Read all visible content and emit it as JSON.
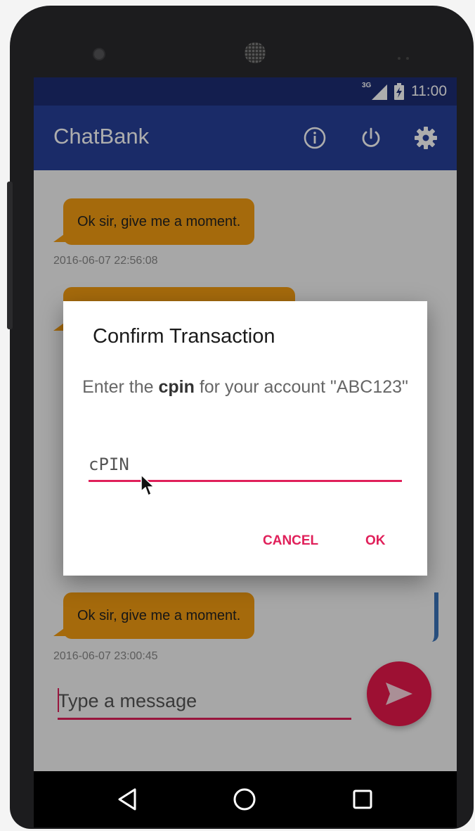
{
  "status_bar": {
    "network": "3G",
    "time": "11:00",
    "icons": [
      "signal-icon",
      "battery-icon"
    ]
  },
  "app_bar": {
    "title": "ChatBank",
    "icons": [
      "info-icon",
      "power-icon",
      "gear-icon"
    ]
  },
  "chat": {
    "messages": [
      {
        "text": "Ok sir, give me a moment.",
        "timestamp": "2016-06-07 22:56:08"
      },
      {
        "text": "Ok sir, give me a moment.",
        "timestamp": "2016-06-07 23:00:45"
      }
    ]
  },
  "composer": {
    "placeholder": "Type a message",
    "send_icon": "send-icon"
  },
  "dialog": {
    "title": "Confirm Transaction",
    "message_prefix": "Enter the ",
    "message_bold": "cpin",
    "message_suffix": " for your account \"ABC123\"",
    "pin_placeholder": "cPIN",
    "cancel_label": "CANCEL",
    "ok_label": "OK"
  },
  "nav_bar": {
    "icons": [
      "back-icon",
      "home-icon",
      "recents-icon"
    ]
  },
  "colors": {
    "status_bar": "#1c2d74",
    "app_bar": "#27409a",
    "bubble": "#f39c12",
    "accent": "#e0205a",
    "fab": "#e8194c"
  }
}
